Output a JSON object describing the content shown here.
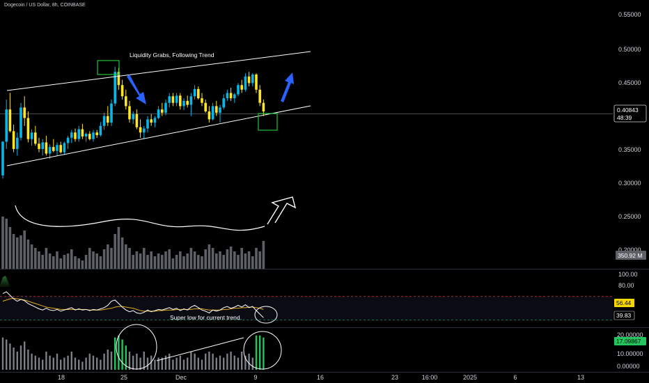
{
  "chart_data": {
    "type": "candlestick",
    "title": "Dogecoin / US Dollar, 8h, COINBASE",
    "colors": {
      "up": "#08b7e8",
      "down": "#ffe620",
      "volume": "#5d6066",
      "rsi_line": "#ffffff",
      "rsi_ma": "#e5ad1f",
      "channel": "#ffffff",
      "box": "#21c23a",
      "arrow": "#2962ff",
      "osc_bar": "#7b7e85",
      "osc_bar_high": "#22c55e",
      "price_line": "#5f6268"
    },
    "price_axis": {
      "ticks": [
        "0.55000",
        "0.50000",
        "0.45000",
        "0.35000",
        "0.30000",
        "0.25000",
        "0.20000"
      ],
      "ylim": [
        0.19,
        0.56
      ]
    },
    "current_price": {
      "value": "0.40843",
      "countdown": "48:39"
    },
    "volume_label": "350.92 M",
    "rsi": {
      "ticks": [
        "100.00",
        "80.00"
      ],
      "value": "56.44",
      "lower_value": "39.83",
      "upper_band": 70,
      "lower_band": 30
    },
    "oscillator": {
      "ticks": [
        "20.00000",
        "10.00000",
        "0.00000"
      ],
      "value": "17.09867"
    },
    "x_axis": {
      "ticks": [
        "18",
        "25",
        "Dec",
        "9",
        "16",
        "23",
        "16:00",
        "2025",
        "6",
        "13"
      ]
    },
    "annotations": {
      "liquidity": "Liquidity Grabs, Following Trend",
      "rsi_note": "Super low for current trend."
    },
    "candles": [
      [
        0.315,
        0.367,
        0.31,
        0.366
      ],
      [
        0.366,
        0.43,
        0.355,
        0.415
      ],
      [
        0.415,
        0.44,
        0.38,
        0.382
      ],
      [
        0.382,
        0.392,
        0.35,
        0.355
      ],
      [
        0.355,
        0.38,
        0.345,
        0.372
      ],
      [
        0.372,
        0.425,
        0.368,
        0.418
      ],
      [
        0.418,
        0.435,
        0.39,
        0.402
      ],
      [
        0.402,
        0.412,
        0.365,
        0.37
      ],
      [
        0.37,
        0.385,
        0.36,
        0.38
      ],
      [
        0.38,
        0.39,
        0.36,
        0.363
      ],
      [
        0.363,
        0.372,
        0.35,
        0.355
      ],
      [
        0.355,
        0.37,
        0.345,
        0.365
      ],
      [
        0.365,
        0.375,
        0.345,
        0.348
      ],
      [
        0.348,
        0.362,
        0.34,
        0.358
      ],
      [
        0.358,
        0.37,
        0.35,
        0.352
      ],
      [
        0.352,
        0.365,
        0.345,
        0.361
      ],
      [
        0.361,
        0.366,
        0.348,
        0.35
      ],
      [
        0.35,
        0.366,
        0.346,
        0.364
      ],
      [
        0.364,
        0.375,
        0.355,
        0.372
      ],
      [
        0.372,
        0.384,
        0.364,
        0.38
      ],
      [
        0.38,
        0.386,
        0.366,
        0.37
      ],
      [
        0.37,
        0.39,
        0.366,
        0.385
      ],
      [
        0.385,
        0.393,
        0.37,
        0.374
      ],
      [
        0.374,
        0.38,
        0.366,
        0.378
      ],
      [
        0.378,
        0.382,
        0.368,
        0.37
      ],
      [
        0.37,
        0.384,
        0.366,
        0.38
      ],
      [
        0.38,
        0.384,
        0.372,
        0.376
      ],
      [
        0.376,
        0.396,
        0.374,
        0.39
      ],
      [
        0.39,
        0.41,
        0.384,
        0.405
      ],
      [
        0.405,
        0.42,
        0.39,
        0.395
      ],
      [
        0.395,
        0.43,
        0.39,
        0.424
      ],
      [
        0.424,
        0.48,
        0.42,
        0.472
      ],
      [
        0.472,
        0.478,
        0.445,
        0.452
      ],
      [
        0.452,
        0.46,
        0.43,
        0.435
      ],
      [
        0.435,
        0.445,
        0.415,
        0.42
      ],
      [
        0.42,
        0.428,
        0.395,
        0.4
      ],
      [
        0.4,
        0.412,
        0.393,
        0.408
      ],
      [
        0.408,
        0.415,
        0.385,
        0.388
      ],
      [
        0.388,
        0.4,
        0.372,
        0.38
      ],
      [
        0.38,
        0.39,
        0.37,
        0.386
      ],
      [
        0.386,
        0.405,
        0.38,
        0.4
      ],
      [
        0.4,
        0.408,
        0.39,
        0.395
      ],
      [
        0.395,
        0.405,
        0.388,
        0.402
      ],
      [
        0.402,
        0.42,
        0.4,
        0.415
      ],
      [
        0.415,
        0.425,
        0.405,
        0.41
      ],
      [
        0.41,
        0.43,
        0.406,
        0.425
      ],
      [
        0.425,
        0.44,
        0.418,
        0.435
      ],
      [
        0.435,
        0.44,
        0.42,
        0.425
      ],
      [
        0.425,
        0.44,
        0.42,
        0.436
      ],
      [
        0.436,
        0.44,
        0.415,
        0.42
      ],
      [
        0.42,
        0.432,
        0.414,
        0.428
      ],
      [
        0.428,
        0.436,
        0.418,
        0.422
      ],
      [
        0.422,
        0.44,
        0.405,
        0.435
      ],
      [
        0.435,
        0.452,
        0.43,
        0.446
      ],
      [
        0.446,
        0.45,
        0.43,
        0.432
      ],
      [
        0.432,
        0.44,
        0.42,
        0.425
      ],
      [
        0.425,
        0.43,
        0.41,
        0.412
      ],
      [
        0.412,
        0.42,
        0.395,
        0.4
      ],
      [
        0.4,
        0.425,
        0.398,
        0.42
      ],
      [
        0.42,
        0.428,
        0.405,
        0.41
      ],
      [
        0.41,
        0.422,
        0.395,
        0.418
      ],
      [
        0.418,
        0.438,
        0.415,
        0.432
      ],
      [
        0.432,
        0.445,
        0.428,
        0.44
      ],
      [
        0.44,
        0.448,
        0.428,
        0.432
      ],
      [
        0.432,
        0.44,
        0.425,
        0.438
      ],
      [
        0.438,
        0.455,
        0.435,
        0.452
      ],
      [
        0.452,
        0.46,
        0.44,
        0.445
      ],
      [
        0.445,
        0.47,
        0.442,
        0.465
      ],
      [
        0.465,
        0.472,
        0.45,
        0.455
      ],
      [
        0.455,
        0.47,
        0.45,
        0.468
      ],
      [
        0.468,
        0.47,
        0.44,
        0.445
      ],
      [
        0.445,
        0.452,
        0.42,
        0.425
      ],
      [
        0.425,
        0.43,
        0.405,
        0.412
      ]
    ],
    "volume": [
      0.75,
      0.72,
      0.6,
      0.5,
      0.45,
      0.48,
      0.55,
      0.42,
      0.35,
      0.3,
      0.25,
      0.2,
      0.3,
      0.22,
      0.18,
      0.25,
      0.15,
      0.2,
      0.22,
      0.28,
      0.18,
      0.15,
      0.12,
      0.2,
      0.3,
      0.25,
      0.22,
      0.18,
      0.28,
      0.35,
      0.3,
      0.5,
      0.6,
      0.45,
      0.35,
      0.3,
      0.2,
      0.25,
      0.22,
      0.3,
      0.2,
      0.25,
      0.18,
      0.22,
      0.2,
      0.25,
      0.28,
      0.15,
      0.2,
      0.25,
      0.18,
      0.22,
      0.3,
      0.25,
      0.2,
      0.18,
      0.28,
      0.35,
      0.3,
      0.22,
      0.25,
      0.2,
      0.28,
      0.32,
      0.25,
      0.2,
      0.3,
      0.22,
      0.25,
      0.18,
      0.3,
      0.25,
      0.4
    ],
    "rsi_values": [
      75,
      78,
      72,
      66,
      62,
      65,
      63,
      58,
      55,
      52,
      49,
      47,
      50,
      47,
      46,
      48,
      45,
      47,
      49,
      51,
      47,
      49,
      47,
      48,
      46,
      48,
      47,
      49,
      51,
      55,
      62,
      64,
      58,
      52,
      47,
      44,
      46,
      42,
      41,
      43,
      47,
      44,
      46,
      48,
      47,
      49,
      51,
      48,
      50,
      46,
      49,
      47,
      52,
      55,
      51,
      47,
      45,
      42,
      47,
      45,
      47,
      51,
      53,
      50,
      52,
      55,
      52,
      56,
      51,
      53,
      46,
      40,
      34
    ],
    "rsi_ma_values": [
      62,
      64,
      66,
      67,
      66,
      65,
      64,
      62,
      60,
      58,
      56,
      54,
      52,
      51,
      50,
      49,
      48,
      48,
      48,
      48,
      48,
      48,
      48,
      48,
      47,
      47,
      47,
      47,
      48,
      49,
      50,
      52,
      53,
      53,
      52,
      51,
      50,
      48,
      46,
      45,
      45,
      45,
      45,
      46,
      46,
      47,
      47,
      47,
      48,
      48,
      48,
      48,
      48,
      49,
      49,
      49,
      48,
      47,
      47,
      47,
      47,
      48,
      48,
      49,
      50,
      50,
      51,
      51,
      52,
      52,
      51,
      50,
      48
    ],
    "osc_values": [
      16,
      15,
      13,
      11,
      9,
      12,
      14,
      10,
      8,
      7,
      6,
      5,
      9,
      7,
      6,
      8,
      5,
      6,
      7,
      9,
      6,
      5,
      4,
      6,
      8,
      7,
      6,
      5,
      8,
      10,
      9,
      16,
      17,
      15,
      12,
      9,
      7,
      8,
      6,
      9,
      6,
      7,
      5,
      6,
      6,
      7,
      8,
      5,
      6,
      7,
      5,
      6,
      9,
      8,
      6,
      5,
      8,
      9,
      8,
      6,
      7,
      6,
      8,
      9,
      7,
      6,
      9,
      7,
      8,
      6,
      17,
      17,
      16
    ],
    "osc_high": [
      31,
      32,
      33,
      34,
      70,
      71,
      72
    ]
  }
}
